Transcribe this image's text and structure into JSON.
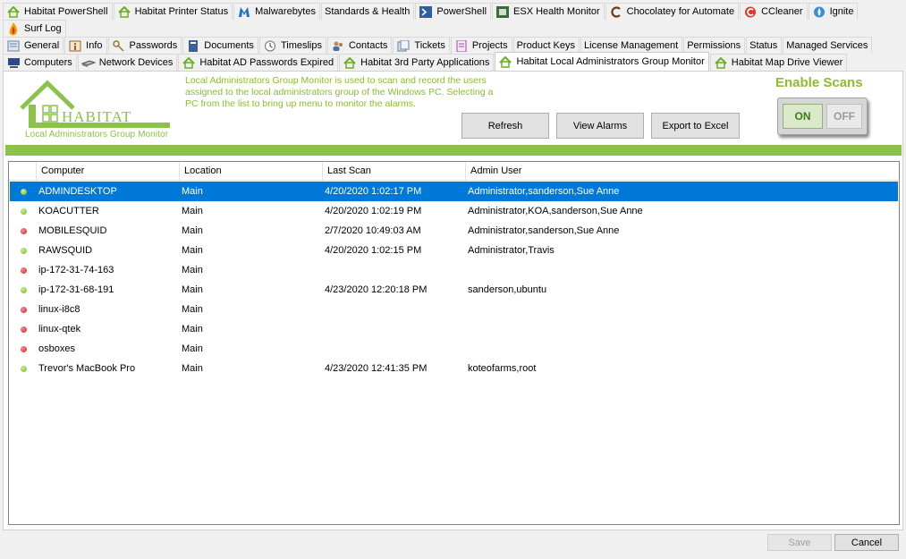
{
  "tabs_row1": [
    {
      "label": "Habitat PowerShell",
      "icon": "habitat-house-icon"
    },
    {
      "label": "Habitat Printer Status",
      "icon": "habitat-house-icon"
    },
    {
      "label": "Malwarebytes",
      "icon": "malwarebytes-icon"
    },
    {
      "label": "Standards & Health",
      "icon": ""
    },
    {
      "label": "PowerShell",
      "icon": "powershell-icon"
    },
    {
      "label": "ESX Health Monitor",
      "icon": "esx-icon"
    },
    {
      "label": "Chocolatey for Automate",
      "icon": "chocolatey-icon"
    },
    {
      "label": "CCleaner",
      "icon": "ccleaner-icon"
    },
    {
      "label": "Ignite",
      "icon": "ignite-icon"
    }
  ],
  "tabs_row2": [
    {
      "label": "Surf Log",
      "icon": "flame-icon"
    }
  ],
  "tabs_row3": [
    {
      "label": "General",
      "icon": "general-icon"
    },
    {
      "label": "Info",
      "icon": "info-icon"
    },
    {
      "label": "Passwords",
      "icon": "key-icon"
    },
    {
      "label": "Documents",
      "icon": "documents-icon"
    },
    {
      "label": "Timeslips",
      "icon": "clock-icon"
    },
    {
      "label": "Contacts",
      "icon": "contacts-icon"
    },
    {
      "label": "Tickets",
      "icon": "tickets-icon"
    },
    {
      "label": "Projects",
      "icon": "projects-icon"
    },
    {
      "label": "Product Keys",
      "icon": ""
    },
    {
      "label": "License Management",
      "icon": ""
    },
    {
      "label": "Permissions",
      "icon": ""
    },
    {
      "label": "Status",
      "icon": ""
    },
    {
      "label": "Managed Services",
      "icon": ""
    }
  ],
  "tabs_row4": [
    {
      "label": "Computers",
      "icon": "computer-icon"
    },
    {
      "label": "Network Devices",
      "icon": "network-device-icon"
    },
    {
      "label": "Habitat AD Passwords Expired",
      "icon": "habitat-house-icon"
    },
    {
      "label": "Habitat 3rd Party Applications",
      "icon": "habitat-house-icon"
    },
    {
      "label": "Habitat Local Administrators Group Monitor",
      "icon": "habitat-house-icon",
      "active": true
    },
    {
      "label": "Habitat Map Drive Viewer",
      "icon": "habitat-house-icon"
    }
  ],
  "logo": {
    "brand": "HABITAT",
    "subtitle": "Local Administrators Group Monitor"
  },
  "description": "Local Administrators Group Monitor is used to scan and record the users assigned to the local administrators group of the Windows PC. Selecting a PC from the list to bring up menu to monitor the alarms.",
  "buttons": {
    "refresh": "Refresh",
    "view_alarms": "View Alarms",
    "export": "Export to Excel"
  },
  "enable_scans": {
    "label": "Enable Scans",
    "on": "ON",
    "off": "OFF",
    "state": "on"
  },
  "grid": {
    "columns": [
      "Computer",
      "Location",
      "Last Scan",
      "Admin User"
    ],
    "rows": [
      {
        "status": "green",
        "computer": "ADMINDESKTOP",
        "location": "Main",
        "last_scan": "4/20/2020 1:02:17 PM",
        "admin": "Administrator,sanderson,Sue Anne",
        "selected": true
      },
      {
        "status": "green",
        "computer": "KOACUTTER",
        "location": "Main",
        "last_scan": "4/20/2020 1:02:19 PM",
        "admin": "Administrator,KOA,sanderson,Sue Anne"
      },
      {
        "status": "red",
        "computer": "MOBILESQUID",
        "location": "Main",
        "last_scan": "2/7/2020 10:49:03 AM",
        "admin": "Administrator,sanderson,Sue Anne"
      },
      {
        "status": "green",
        "computer": "RAWSQUID",
        "location": "Main",
        "last_scan": "4/20/2020 1:02:15 PM",
        "admin": "Administrator,Travis"
      },
      {
        "status": "red",
        "computer": "ip-172-31-74-163",
        "location": "Main",
        "last_scan": "",
        "admin": ""
      },
      {
        "status": "green",
        "computer": "ip-172-31-68-191",
        "location": "Main",
        "last_scan": "4/23/2020 12:20:18 PM",
        "admin": "sanderson,ubuntu"
      },
      {
        "status": "red",
        "computer": "linux-i8c8",
        "location": "Main",
        "last_scan": "",
        "admin": ""
      },
      {
        "status": "red",
        "computer": "linux-qtek",
        "location": "Main",
        "last_scan": "",
        "admin": ""
      },
      {
        "status": "red",
        "computer": "osboxes",
        "location": "Main",
        "last_scan": "",
        "admin": ""
      },
      {
        "status": "green",
        "computer": "Trevor's MacBook Pro",
        "location": "Main",
        "last_scan": "4/23/2020 12:41:35 PM",
        "admin": "koteofarms,root"
      }
    ]
  },
  "footer": {
    "save": "Save",
    "cancel": "Cancel"
  },
  "colors": {
    "accent": "#8bc34a",
    "accent_text": "#8bbe2e",
    "selection": "#0078d7",
    "status_green": "#73b82a",
    "status_red": "#d62020"
  }
}
